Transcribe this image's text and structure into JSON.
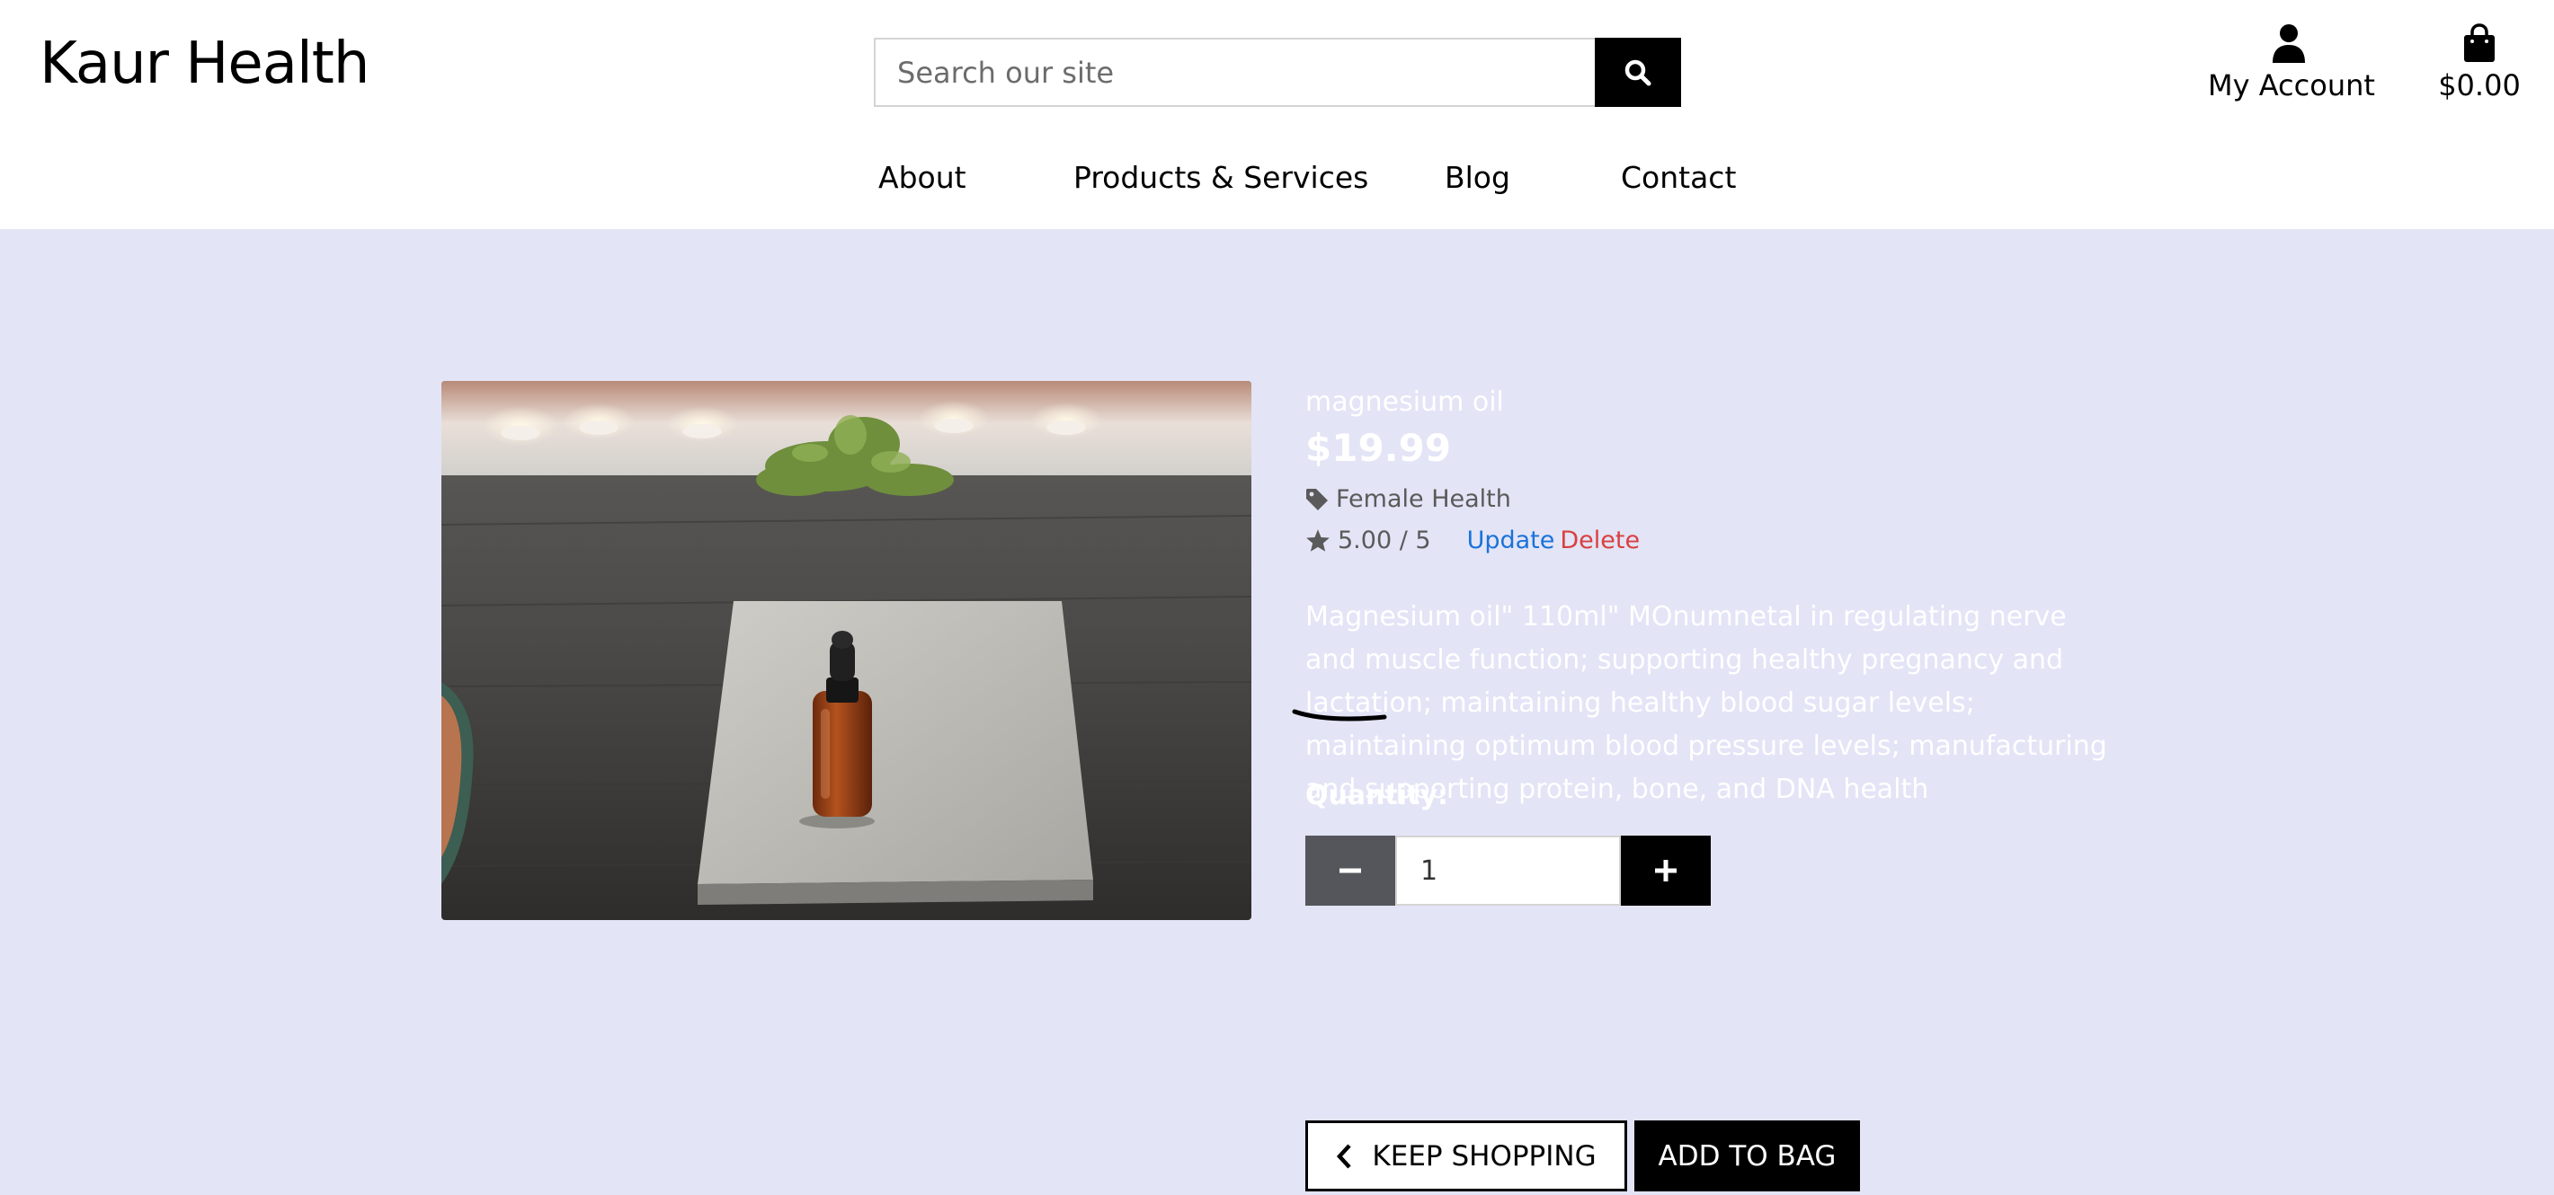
{
  "header": {
    "logo": "Kaur Health",
    "search": {
      "placeholder": "Search our site"
    },
    "account_label": "My Account",
    "bag_total": "$0.00"
  },
  "nav": {
    "items": [
      {
        "label": "About"
      },
      {
        "label": "Products & Services"
      },
      {
        "label": "Blog"
      },
      {
        "label": "Contact"
      }
    ]
  },
  "product": {
    "name": "magnesium oil",
    "price": "$19.99",
    "category": "Female Health",
    "rating": "5.00 / 5",
    "update_label": "Update",
    "delete_label": "Delete",
    "description": "Magnesium oil\" 110ml\" MOnumnetal in regulating nerve and muscle function; supporting healthy pregnancy and lactation; maintaining healthy blood sugar levels; maintaining optimum blood pressure levels; manufacturing and supporting protein, bone, and DNA health",
    "quantity_label": "Quantity:",
    "quantity_value": "1"
  },
  "actions": {
    "keep_shopping": "KEEP SHOPPING",
    "add_to_bag": "ADD TO BAG"
  },
  "icons": {
    "search": "search-icon",
    "account": "user-icon",
    "bag": "shopping-bag-icon",
    "category": "tag-icon",
    "rating": "star-icon",
    "minus": "minus-icon",
    "plus": "plus-icon",
    "back": "chevron-left-icon"
  },
  "colors": {
    "page_background": "#e3e4f6",
    "update_link": "#1a73d9",
    "delete_link": "#d94040",
    "minus_button": "#54565b",
    "dark_button": "#000000"
  }
}
